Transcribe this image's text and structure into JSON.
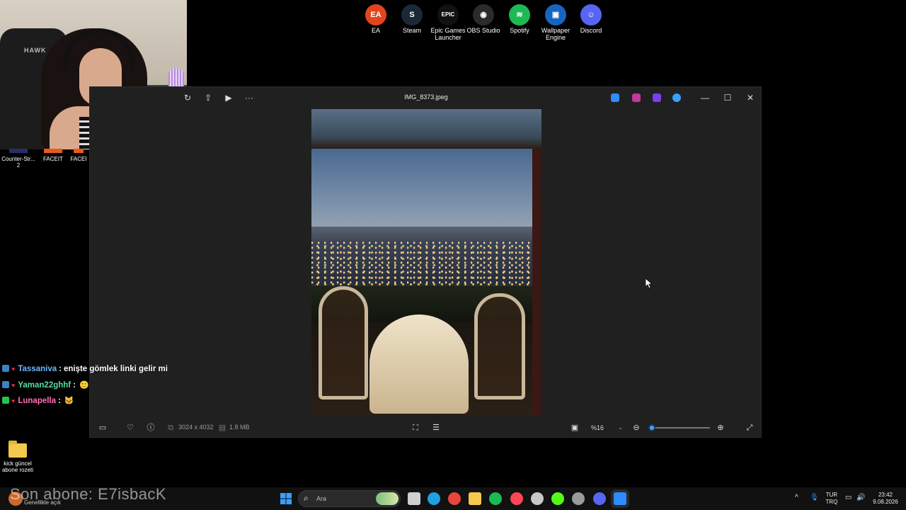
{
  "desktop_icons": [
    {
      "label": "EA",
      "color": "#e4441d",
      "glyph": "EA"
    },
    {
      "label": "Steam",
      "color": "#1b2838",
      "glyph": "S"
    },
    {
      "label": "Epic Games Launcher",
      "color": "#111111",
      "glyph": "EPIC"
    },
    {
      "label": "OBS Studio",
      "color": "#2b2b2b",
      "glyph": "◉"
    },
    {
      "label": "Spotify",
      "color": "#1db954",
      "glyph": "≋"
    },
    {
      "label": "Wallpaper Engine",
      "color": "#1565c0",
      "glyph": "▣"
    },
    {
      "label": "Discord",
      "color": "#5865f2",
      "glyph": "☺"
    }
  ],
  "left_shortcuts": [
    {
      "label": "Counter-Str... 2"
    },
    {
      "label": "FACEIT"
    },
    {
      "label": "FACEI"
    }
  ],
  "webcam": {
    "chair_text": "HAWK"
  },
  "photos_window": {
    "title": "IMG_8373.jpeg",
    "left_tools": [
      "rotate-icon",
      "share-icon",
      "slideshow-icon",
      "more-icon"
    ],
    "more_glyph": "···",
    "app_icons": [
      {
        "name": "photos-icon",
        "color": "#2d8cff"
      },
      {
        "name": "clipchamp-icon",
        "color": "#c2389b"
      },
      {
        "name": "designer-icon",
        "color": "#7b3ff2"
      },
      {
        "name": "onedrive-icon",
        "color": "#3aa0ff"
      }
    ],
    "controls": {
      "minimize": "—",
      "maximize": "☐",
      "close": "✕"
    },
    "bottom": {
      "dimensions": "3024 x 4032",
      "file_size": "1.8 MB",
      "zoom_value": "%16",
      "zoom_level": 0.0
    }
  },
  "chat": [
    {
      "user": "Tassaniva",
      "color": "#6cb6ff",
      "message": "enişte gömlek linki gelir mi",
      "badge_color": "#3b82c4",
      "heart_color": "#e02d3c",
      "emote": ""
    },
    {
      "user": "Yaman22ghhf",
      "color": "#53e0a0",
      "message": "",
      "badge_color": "#3b82c4",
      "heart_color": "#e02d3c",
      "emote": "🙂"
    },
    {
      "user": "Lunapella",
      "color": "#ff6fb5",
      "message": "",
      "badge_color": "#24c44a",
      "heart_color": "#e02d3c",
      "emote": "🐱"
    }
  ],
  "chat_separator": ":",
  "folder": {
    "label": "kick güncel abone rozeti"
  },
  "overlay": {
    "last_sub_label": "Son abone: E7isbacK",
    "small_text": "Genellikle açık"
  },
  "taskbar": {
    "search_placeholder": "Ara",
    "apps": [
      {
        "name": "task-view-icon",
        "color": "#cfcfcf"
      },
      {
        "name": "edge-icon",
        "color": "#1fa0e0"
      },
      {
        "name": "chrome-icon",
        "color": "#e8453c"
      },
      {
        "name": "file-explorer-icon",
        "color": "#f2c94c"
      },
      {
        "name": "spotify-taskbar-icon",
        "color": "#1db954"
      },
      {
        "name": "valorant-icon",
        "color": "#ff4655"
      },
      {
        "name": "steam-taskbar-icon",
        "color": "#c8c8c8"
      },
      {
        "name": "kick-icon",
        "color": "#53fc18"
      },
      {
        "name": "obs-taskbar-icon",
        "color": "#9a9a9a"
      },
      {
        "name": "discord-taskbar-icon",
        "color": "#5865f2"
      },
      {
        "name": "photos-taskbar-icon",
        "color": "#2d8cff"
      }
    ],
    "tray": {
      "chevron": "^",
      "lang_top": "TUR",
      "lang_bottom": "TRQ",
      "time": "23:42",
      "date": "9.08.2026"
    }
  }
}
